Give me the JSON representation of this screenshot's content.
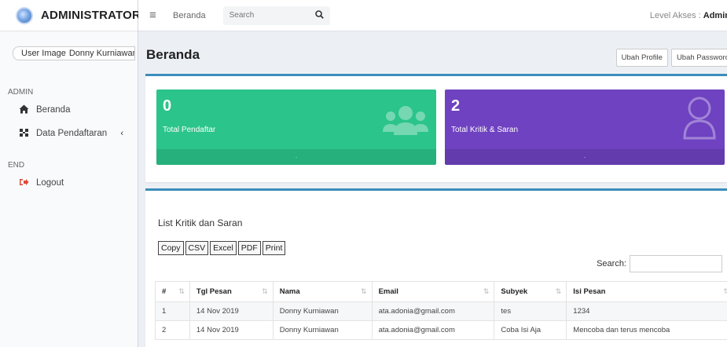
{
  "brand": {
    "title": "ADMINISTRATOR"
  },
  "user": {
    "image_alt": "User Image",
    "name": "Donny Kurniawan"
  },
  "sidebar": {
    "section_admin": "ADMIN",
    "items": [
      {
        "label": "Beranda",
        "icon": "home-icon"
      },
      {
        "label": "Data Pendaftaran",
        "icon": "data-icon"
      }
    ],
    "section_end": "END",
    "logout": {
      "label": "Logout",
      "icon": "logout-icon"
    }
  },
  "navbar": {
    "breadcrumb": "Beranda",
    "search_placeholder": "Search",
    "level_label": "Level Akses : ",
    "level_value": "Admin"
  },
  "header": {
    "title": "Beranda",
    "btn_profile": "Ubah Profile",
    "btn_password": "Ubah Password"
  },
  "stats": [
    {
      "value": "0",
      "label": "Total Pendaftar",
      "color": "#2bc48a",
      "icon": "users-icon"
    },
    {
      "value": "2",
      "label": "Total Kritik & Saran",
      "color": "#6f42c1",
      "icon": "user-icon"
    }
  ],
  "table_card": {
    "title": "List Kritik dan Saran",
    "buttons": [
      "Copy",
      "CSV",
      "Excel",
      "PDF",
      "Print"
    ],
    "search_label": "Search:",
    "columns": [
      "#",
      "Tgl Pesan",
      "Nama",
      "Email",
      "Subyek",
      "Isi Pesan"
    ],
    "rows": [
      [
        "1",
        "14 Nov 2019",
        "Donny Kurniawan",
        "ata.adonia@gmail.com",
        "tes",
        "1234"
      ],
      [
        "2",
        "14 Nov 2019",
        "Donny Kurniawan",
        "ata.adonia@gmail.com",
        "Coba Isi Aja",
        "Mencoba dan terus mencoba"
      ]
    ]
  }
}
